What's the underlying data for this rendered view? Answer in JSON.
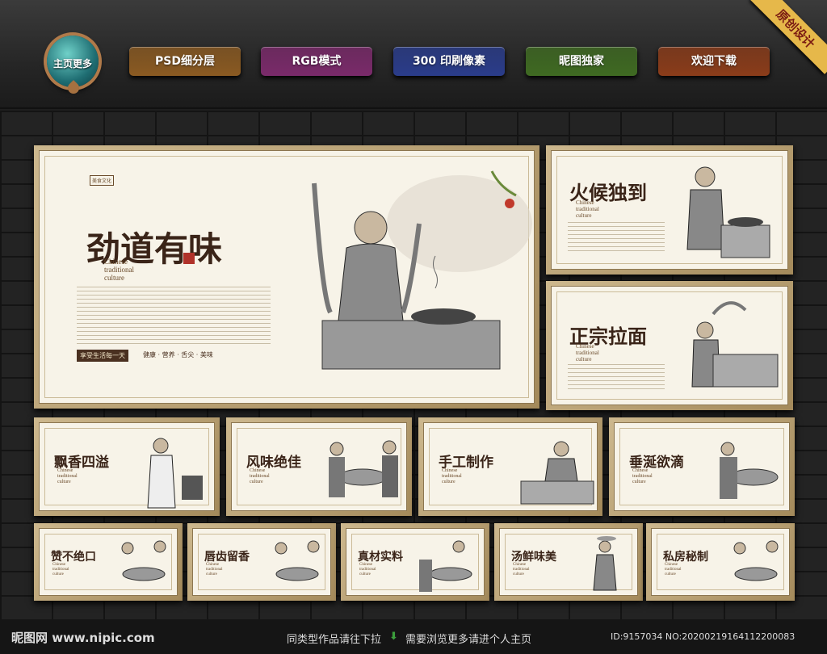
{
  "header": {
    "logo_label": "主页更多",
    "buttons": [
      {
        "label": "PSD细分层",
        "color": "#8a5a22"
      },
      {
        "label": "RGB模式",
        "color": "#7a2a6a"
      },
      {
        "label": "300 印刷像素",
        "color": "#2a3c8a"
      },
      {
        "label": "昵图独家",
        "color": "#3f6a22"
      },
      {
        "label": "欢迎下载",
        "color": "#8a3c1a"
      }
    ],
    "ribbon": "原创设计"
  },
  "main_panel": {
    "tag": "美食文化",
    "title": "劲道有味",
    "english": "Chinese\ntraditional\nculture",
    "slogan": "享受生活每一天",
    "keywords": "健康 · 营养 · 舌尖 · 美味"
  },
  "panels": [
    {
      "title": "火候独到",
      "english": "Chinese\ntraditional\nculture"
    },
    {
      "title": "正宗拉面",
      "english": "Chinese\ntraditional\nculture"
    },
    {
      "title": "飘香四溢",
      "english": "Chinese\ntraditional\nculture"
    },
    {
      "title": "风味绝佳",
      "english": "Chinese\ntraditional\nculture"
    },
    {
      "title": "手工制作",
      "english": "Chinese\ntraditional\nculture"
    },
    {
      "title": "垂涎欲滴",
      "english": "Chinese\ntraditional\nculture"
    },
    {
      "title": "赞不绝口",
      "english": "Chinese\ntraditional\nculture"
    },
    {
      "title": "唇齿留香",
      "english": "Chinese\ntraditional\nculture"
    },
    {
      "title": "真材实料",
      "english": "Chinese\ntraditional\nculture"
    },
    {
      "title": "汤鲜味美",
      "english": "Chinese\ntraditional\nculture"
    },
    {
      "title": "私房秘制",
      "english": "Chinese\ntraditional\nculture"
    }
  ],
  "footer": {
    "site": "昵图网 www.nipic.com",
    "hint_left": "同类型作品请往下拉",
    "hint_right": "需要浏览更多请进个人主页",
    "id_text": "ID:9157034 NO:20200219164112200083"
  }
}
